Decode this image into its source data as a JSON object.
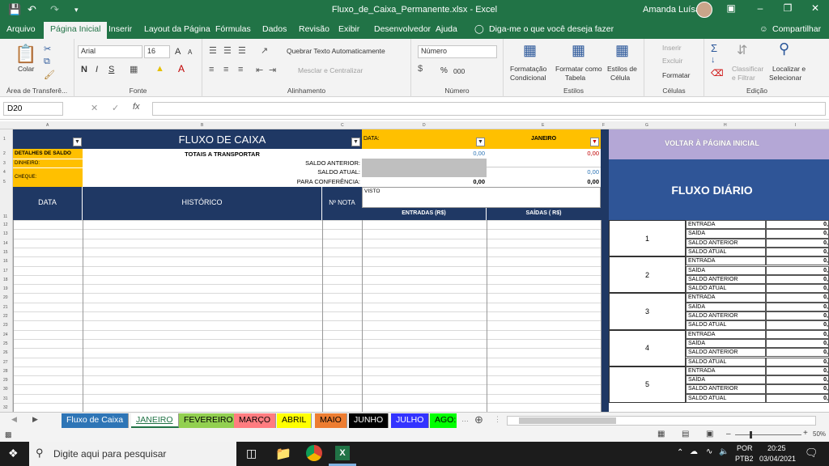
{
  "window": {
    "title": "Fluxo_de_Caixa_Permanente.xlsx  -  Excel",
    "user": "Amanda Luísa"
  },
  "ribbon_tabs": [
    "Arquivo",
    "Página Inicial",
    "Inserir",
    "Layout da Página",
    "Fórmulas",
    "Dados",
    "Revisão",
    "Exibir",
    "Desenvolvedor",
    "Ajuda"
  ],
  "tell_me": "Diga-me o que você deseja fazer",
  "share": "Compartilhar",
  "ribbon": {
    "clipboard": {
      "paste": "Colar",
      "label": "Área de Transferê..."
    },
    "font": {
      "name": "Arial",
      "size": "16",
      "label": "Fonte",
      "grow": "A",
      "shrink": "A"
    },
    "alignment": {
      "wrap": "Quebrar Texto Automaticamente",
      "merge": "Mesclar e Centralizar",
      "label": "Alinhamento"
    },
    "number": {
      "format": "Número",
      "pct": "%",
      "thousands": "000",
      "label": "Número"
    },
    "styles": {
      "cond": "Formatação",
      "cond2": "Condicional",
      "table": "Formatar como",
      "table2": "Tabela",
      "cell": "Estilos de",
      "cell2": "Célula",
      "label": "Estilos"
    },
    "cells": {
      "insert": "Inserir",
      "delete": "Excluir",
      "format": "Formatar",
      "label": "Células"
    },
    "editing": {
      "sort": "Classificar",
      "sort2": "e Filtrar",
      "find": "Localizar e",
      "find2": "Selecionar",
      "label": "Edição"
    }
  },
  "namebox": "D20",
  "fx": "fx",
  "columns": [
    "A",
    "B",
    "C",
    "D",
    "E",
    "F",
    "G",
    "H",
    "I"
  ],
  "rows": [
    "1",
    "2",
    "3",
    "4",
    "5",
    "",
    "",
    "",
    "",
    "",
    "11",
    "12",
    "13",
    "14",
    "15",
    "16",
    "17",
    "18",
    "19",
    "20",
    "21",
    "22",
    "23",
    "24",
    "25",
    "26",
    "27",
    "28",
    "29",
    "30",
    "31",
    "32"
  ],
  "sheet": {
    "title": "FLUXO DE CAIXA",
    "data_label": "DATA:",
    "month": "JANEIRO",
    "detalhes": "DETALHES DE SALDO",
    "totais": "TOTAIS A TRANSPORTAR",
    "dinheiro": "DINHEIRO:",
    "cheque": "CHEQUE:",
    "saldo_anterior": "SALDO ANTERIOR:",
    "saldo_atual": "SALDO ATUAL:",
    "conferencia": "PARA CONFERÊNCIA:",
    "val_entradas_total": "0,00",
    "val_saidas_total": "0,00",
    "val_saldo_atual": "0,00",
    "val_conf_entradas": "0,00",
    "val_conf_saidas": "0,00",
    "visto": "VISTO",
    "h_data": "DATA",
    "h_hist": "HISTÓRICO",
    "h_nota": "Nº NOTA",
    "h_entradas": "ENTRADAS (R$)",
    "h_saidas": "SAÍDAS ( R$)",
    "voltar": "VOLTAR À PÁGINA INICIAL",
    "fluxo_diario": "FLUXO DIÁRIO",
    "days": [
      {
        "n": "1",
        "rows": [
          "ENTRADA",
          "SAÍDA",
          "SALDO ANTERIOR",
          "SALDO ATUAL"
        ]
      },
      {
        "n": "2",
        "rows": [
          "ENTRADA",
          "SAÍDA",
          "SALDO ANTERIOR",
          "SALDO ATUAL"
        ]
      },
      {
        "n": "3",
        "rows": [
          "ENTRADA",
          "SAÍDA",
          "SALDO ANTERIOR",
          "SALDO ATUAL"
        ]
      },
      {
        "n": "4",
        "rows": [
          "ENTRADA",
          "SAÍDA",
          "SALDO ANTERIOR",
          "SALDO ATUAL"
        ]
      },
      {
        "n": "5",
        "rows": [
          "ENTRADA",
          "SAÍDA",
          "SALDO ANTERIOR",
          "SALDO ATUAL"
        ]
      }
    ],
    "day_value": "0,"
  },
  "sheet_tabs": [
    {
      "label": "Fluxo de Caixa",
      "bg": "#2e75b6",
      "fg": "#ffffff"
    },
    {
      "label": "JANEIRO",
      "bg": "#ffffff",
      "fg": "#217346"
    },
    {
      "label": "FEVEREIRO",
      "bg": "#92d050",
      "fg": "#000000"
    },
    {
      "label": "MARÇO",
      "bg": "#ff7c80",
      "fg": "#000000"
    },
    {
      "label": "ABRIL",
      "bg": "#ffff00",
      "fg": "#000000"
    },
    {
      "label": "MAIO",
      "bg": "#ed7d31",
      "fg": "#000000"
    },
    {
      "label": "JUNHO",
      "bg": "#000000",
      "fg": "#ffffff"
    },
    {
      "label": "JULHO",
      "bg": "#3333ff",
      "fg": "#ffffff"
    },
    {
      "label": "AGO:",
      "bg": "#00ff00",
      "fg": "#000000"
    }
  ],
  "status": {
    "zoom": "50%"
  },
  "taskbar": {
    "search": "Digite aqui para pesquisar",
    "lang": "POR",
    "layout": "PTB2",
    "time": "20:25",
    "date": "03/04/2021"
  }
}
